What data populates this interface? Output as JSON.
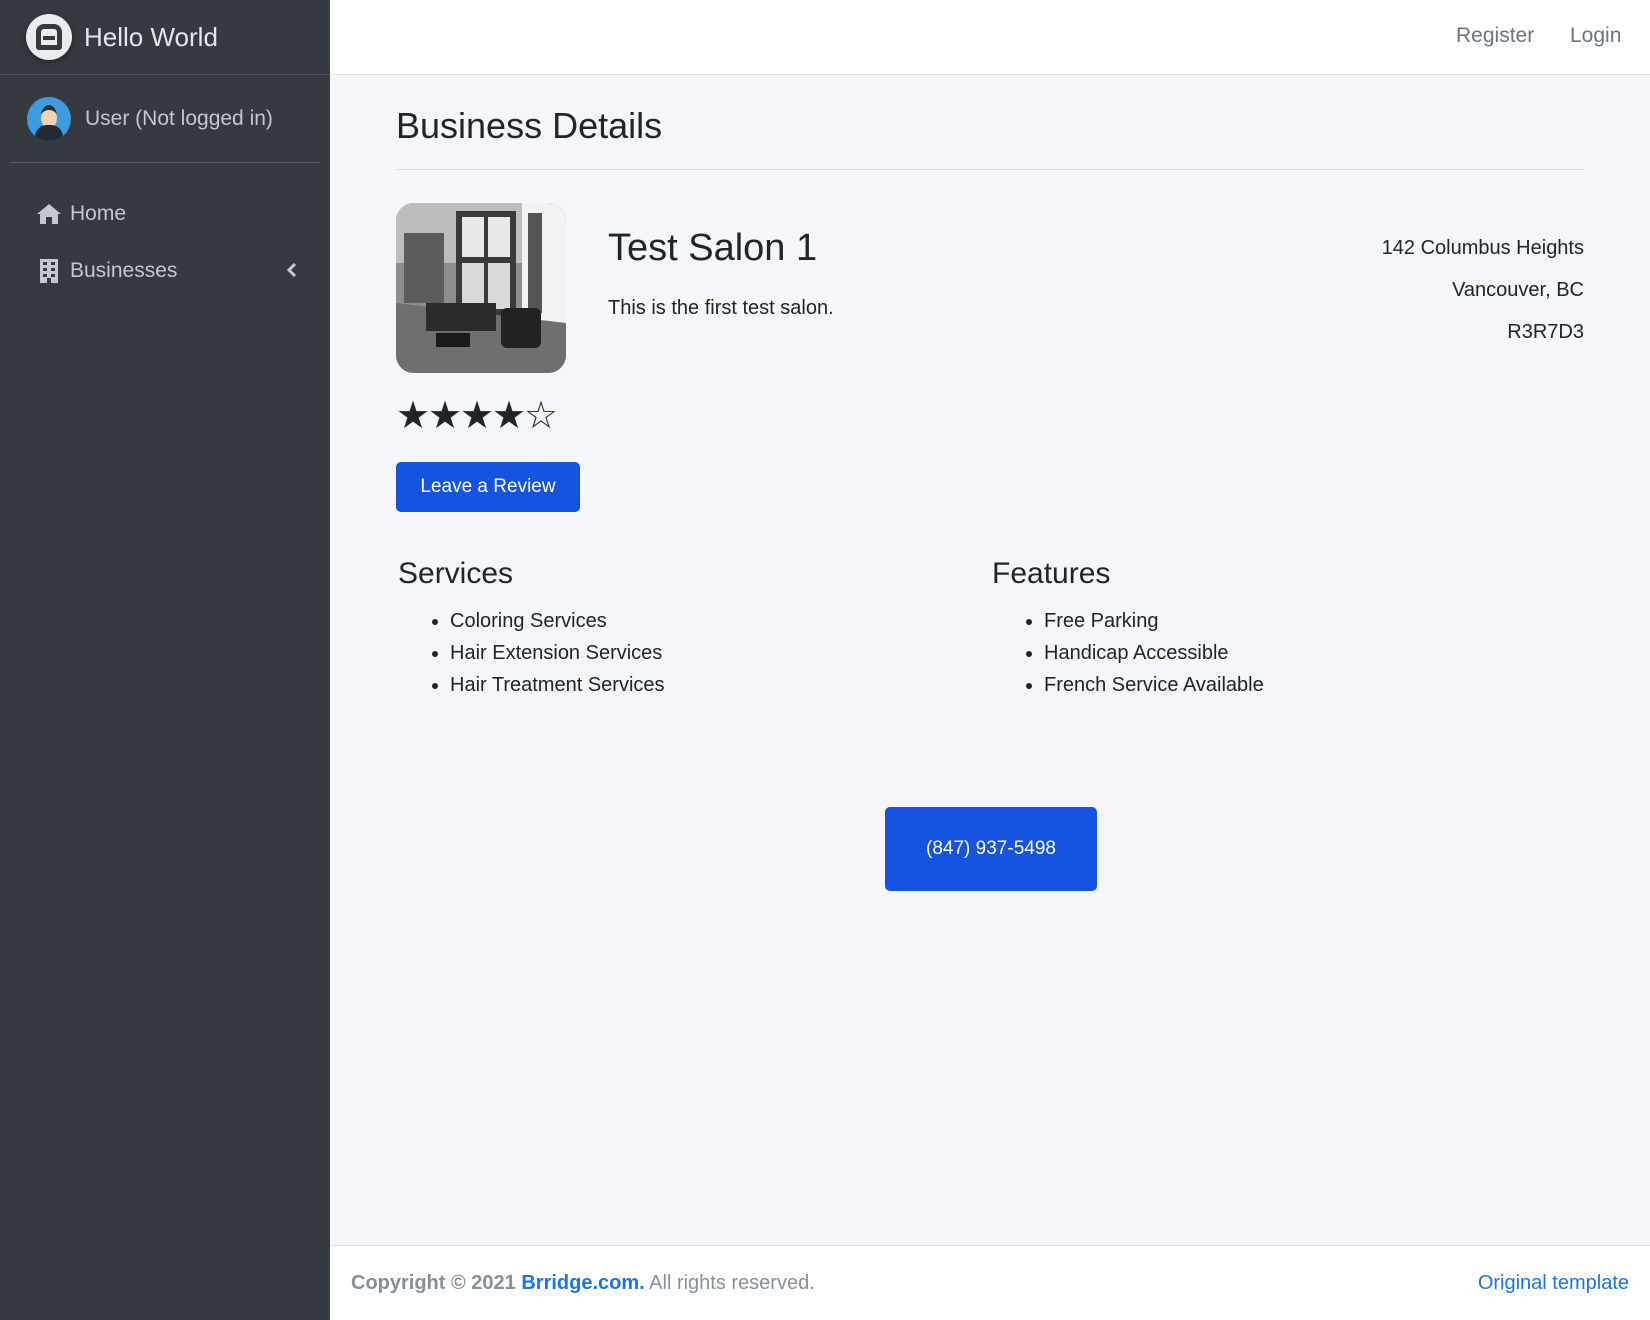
{
  "brand": {
    "name": "Hello World"
  },
  "user": {
    "name": "User (Not logged in)"
  },
  "sidebar": {
    "items": [
      {
        "label": "Home",
        "icon": "home-icon"
      },
      {
        "label": "Businesses",
        "icon": "building-icon"
      }
    ]
  },
  "navbar": {
    "register": "Register",
    "login": "Login"
  },
  "page": {
    "title": "Business Details"
  },
  "business": {
    "name": "Test Salon 1",
    "description": "This is the first test salon.",
    "address": {
      "street": "142 Columbus Heights",
      "city": "Vancouver, BC",
      "postal": "R3R7D3"
    },
    "rating": 4,
    "rating_max": 5,
    "review_button": "Leave a Review",
    "phone": "(847) 937-5498"
  },
  "services": {
    "title": "Services",
    "items": [
      "Coloring Services",
      "Hair Extension Services",
      "Hair Treatment Services"
    ]
  },
  "features": {
    "title": "Features",
    "items": [
      "Free Parking",
      "Handicap Accessible",
      "French Service Available"
    ]
  },
  "footer": {
    "copyright_prefix": "Copyright © 2021",
    "site": "Brridge.com.",
    "rights": "All rights reserved.",
    "template_link": "Original template"
  },
  "colors": {
    "sidebar": "#343a40",
    "primary": "#1553e0",
    "link": "#1a73e8",
    "background": "#f4f6f9"
  }
}
